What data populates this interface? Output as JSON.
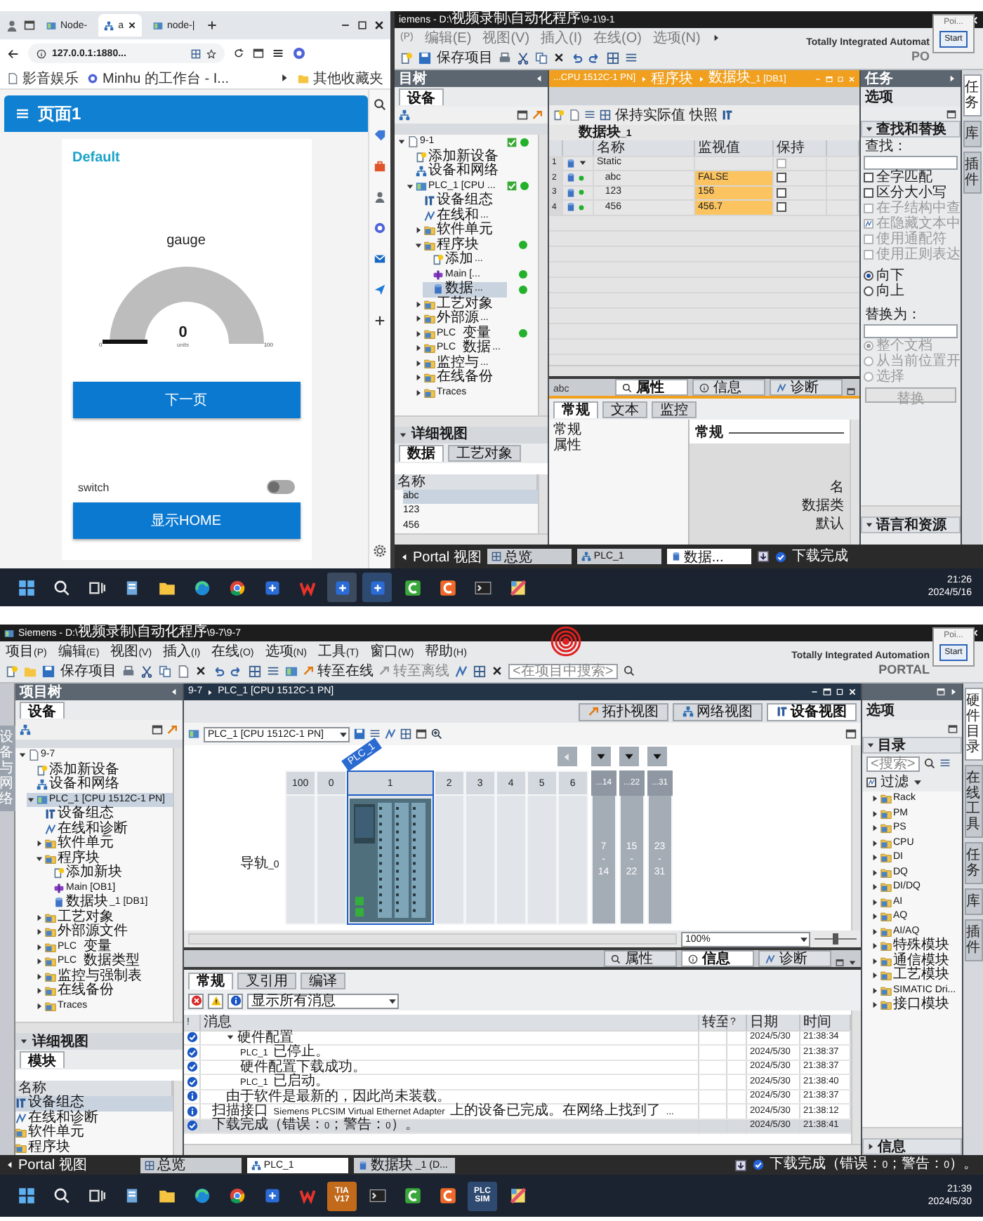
{
  "top_screen": {
    "browser": {
      "tabs": [
        {
          "label": "Node-",
          "selected": false
        },
        {
          "label": "a",
          "selected": true
        },
        {
          "label": "node-|",
          "selected": false
        }
      ],
      "address": "127.0.0.1:1880...",
      "bookmarks": [
        {
          "label": "影音娱乐",
          "kind": "page"
        },
        {
          "label": "Minhu 的工作台 - I...",
          "kind": "site"
        }
      ],
      "other_bookmarks": "其他收藏夹",
      "dashboard": {
        "title": "页面1",
        "group": "Default",
        "gauge": {
          "title": "gauge",
          "value": "0",
          "units": "units",
          "min": "0",
          "max": "100"
        },
        "next_button": "下一页",
        "switch": {
          "label": "switch",
          "on": false
        },
        "home_button": "显示HOME"
      }
    },
    "tia": {
      "title": "iemens - D:\\视频录制\\自动化程序\\9-1\\9-1",
      "menu": [
        "(P)",
        "编辑(E)",
        "视图(V)",
        "插入(I)",
        "在线(O)",
        "选项(N)"
      ],
      "save": "保存项目",
      "brand": "Totally Integrated Automat",
      "portal": "PO",
      "popup": {
        "title": "Poi...",
        "button": "Start"
      },
      "tree": {
        "header": "目树",
        "tab": "设备",
        "items": [
          {
            "label": "9-1",
            "kind": "project",
            "expanded": true,
            "consistent": true,
            "online": true,
            "selected": false,
            "children": [
              {
                "label": "添加新设备",
                "kind": "add",
                "selected": false
              },
              {
                "label": "设备和网络",
                "kind": "network",
                "selected": false
              },
              {
                "label": "PLC_1 [CPU ...",
                "kind": "plc",
                "expanded": true,
                "consistent": true,
                "online": true,
                "selected": false,
                "children": [
                  {
                    "label": "设备组态",
                    "kind": "config",
                    "selected": false
                  },
                  {
                    "label": "在线和...",
                    "kind": "diag",
                    "selected": false
                  },
                  {
                    "label": "软件单元",
                    "kind": "folder",
                    "expanded": false,
                    "selected": false
                  },
                  {
                    "label": "程序块",
                    "kind": "folder",
                    "expanded": true,
                    "online": true,
                    "selected": false,
                    "children": [
                      {
                        "label": "添加...",
                        "kind": "add",
                        "selected": false
                      },
                      {
                        "label": "Main [...",
                        "kind": "ob",
                        "online": true,
                        "selected": false
                      },
                      {
                        "label": "数据...",
                        "kind": "db",
                        "online": true,
                        "selected": true
                      }
                    ]
                  },
                  {
                    "label": "工艺对象",
                    "kind": "folder",
                    "expanded": false,
                    "selected": false
                  },
                  {
                    "label": "外部源...",
                    "kind": "folder",
                    "expanded": false,
                    "selected": false
                  },
                  {
                    "label": "PLC 变量",
                    "kind": "folder",
                    "expanded": false,
                    "online": true,
                    "selected": false
                  },
                  {
                    "label": "PLC 数据...",
                    "kind": "folder",
                    "expanded": false,
                    "selected": false
                  },
                  {
                    "label": "监控与...",
                    "kind": "folder",
                    "expanded": false,
                    "selected": false
                  },
                  {
                    "label": "在线备份",
                    "kind": "folder",
                    "expanded": false,
                    "selected": false
                  },
                  {
                    "label": "Traces",
                    "kind": "folder",
                    "expanded": false,
                    "selected": false
                  }
                ]
              }
            ]
          }
        ]
      },
      "detail": {
        "header": "详细视图",
        "tabs": [
          {
            "label": "数据",
            "selected": true
          },
          {
            "label": "工艺对象",
            "selected": false
          }
        ],
        "column": "名称",
        "rows": [
          {
            "label": "abc",
            "selected": true
          },
          {
            "label": "123",
            "selected": false
          },
          {
            "label": "456",
            "selected": false
          }
        ]
      },
      "editor": {
        "breadcrumb": [
          "...CPU 1512C-1 PN]",
          "程序块",
          "数据块_1 [DB1]"
        ],
        "tools": [
          "保持实际值",
          "快照"
        ],
        "block_title": "数据块_1",
        "columns": [
          "名称",
          "监视值",
          "保持"
        ],
        "rows": [
          {
            "no": "1",
            "name": "Static",
            "kind": "struct",
            "expanded": true,
            "retain": false
          },
          {
            "no": "2",
            "name": "abc",
            "kind": "var",
            "value": "FALSE",
            "retain": false
          },
          {
            "no": "3",
            "name": "123",
            "kind": "var",
            "value": "156",
            "retain": false
          },
          {
            "no": "4",
            "name": "456",
            "kind": "var",
            "value": "456.7",
            "retain": false
          }
        ]
      },
      "inspector": {
        "object": "abc",
        "tabs": [
          {
            "label": "属性",
            "kind": "props",
            "selected": true
          },
          {
            "label": "信息",
            "kind": "info",
            "selected": false
          },
          {
            "label": "诊断",
            "kind": "diag",
            "selected": false
          }
        ],
        "subtabs": [
          {
            "label": "常规",
            "selected": true
          },
          {
            "label": "文本",
            "selected": false
          },
          {
            "label": "监控",
            "selected": false
          }
        ],
        "nav": [
          "常规",
          "属性"
        ],
        "section": "常规",
        "fields": [
          "名",
          "数据类",
          "默认"
        ]
      },
      "tasks": {
        "header": "任务",
        "options": "选项",
        "find_section": "查找和替换",
        "find_label": "查找：",
        "checks": [
          {
            "label": "全字匹配",
            "checked": false,
            "disabled": false
          },
          {
            "label": "区分大小写",
            "checked": false,
            "disabled": false
          },
          {
            "label": "在子结构中查",
            "checked": false,
            "disabled": true
          },
          {
            "label": "在隐藏文本中",
            "checked": true,
            "disabled": true
          },
          {
            "label": "使用通配符",
            "checked": false,
            "disabled": true
          },
          {
            "label": "使用正则表达",
            "checked": false,
            "disabled": true
          }
        ],
        "direction": [
          {
            "label": "向下",
            "selected": true,
            "disabled": false
          },
          {
            "label": "向上",
            "selected": false,
            "disabled": false
          }
        ],
        "replace_label": "替换为：",
        "scope": [
          {
            "label": "整个文档",
            "selected": true,
            "disabled": true
          },
          {
            "label": "从当前位置开",
            "selected": false,
            "disabled": true
          },
          {
            "label": "选择",
            "selected": false,
            "disabled": true
          }
        ],
        "replace_button": "替换",
        "lang_section": "语言和资源"
      },
      "side_tabs": [
        {
          "label": "任务",
          "selected": true
        },
        {
          "label": "库",
          "selected": false
        },
        {
          "label": "插件",
          "selected": false
        }
      ],
      "status_bar": {
        "portal": "Portal 视图",
        "windows": [
          {
            "label": "总览",
            "kind": "overview",
            "selected": false
          },
          {
            "label": "PLC_1",
            "kind": "plc",
            "selected": false
          },
          {
            "label": "数据...",
            "kind": "db",
            "selected": true
          }
        ],
        "message": "下载完成"
      }
    },
    "taskbar": {
      "apps": [
        {
          "kind": "start",
          "selected": false
        },
        {
          "kind": "search",
          "selected": false
        },
        {
          "kind": "taskview",
          "selected": false
        },
        {
          "kind": "notes",
          "selected": false
        },
        {
          "kind": "folder",
          "selected": false
        },
        {
          "kind": "edge",
          "selected": false
        },
        {
          "kind": "chrome",
          "selected": false
        },
        {
          "kind": "app",
          "selected": false
        },
        {
          "kind": "wps",
          "selected": false
        },
        {
          "kind": "tia",
          "selected": false
        },
        {
          "kind": "plcsim",
          "selected": false
        },
        {
          "kind": "c-green",
          "selected": false
        },
        {
          "kind": "c-orange",
          "selected": false
        },
        {
          "kind": "terminal",
          "selected": false
        },
        {
          "kind": "paint",
          "selected": false
        }
      ],
      "time": "21:26",
      "date": "2024/5/16"
    }
  },
  "bottom_screen": {
    "tia": {
      "title": "Siemens - D:\\视频录制\\自动化程序\\9-7\\9-7",
      "menu": [
        "项目(P)",
        "编辑(E)",
        "视图(V)",
        "插入(I)",
        "在线(O)",
        "选项(N)",
        "工具(T)",
        "窗口(W)",
        "帮助(H)"
      ],
      "toolbar": {
        "save": "保存项目",
        "online": "转至在线",
        "offline": "转至离线",
        "search_placeholder": "<在项目中搜索>"
      },
      "brand": "Totally Integrated Automation",
      "portal": "PORTAL",
      "popup": {
        "title": "Poi...",
        "button": "Start"
      },
      "left_tab": "设备与网络",
      "tree": {
        "header": "项目树",
        "tab": "设备",
        "items": [
          {
            "label": "9-7",
            "kind": "project",
            "expanded": true,
            "selected": false,
            "children": [
              {
                "label": "添加新设备",
                "kind": "add",
                "selected": false
              },
              {
                "label": "设备和网络",
                "kind": "network",
                "selected": false
              },
              {
                "label": "PLC_1 [CPU 1512C-1 PN]",
                "kind": "plc",
                "expanded": true,
                "selected": true,
                "children": [
                  {
                    "label": "设备组态",
                    "kind": "config",
                    "selected": false
                  },
                  {
                    "label": "在线和诊断",
                    "kind": "diag",
                    "selected": false
                  },
                  {
                    "label": "软件单元",
                    "kind": "folder",
                    "expanded": false,
                    "selected": false
                  },
                  {
                    "label": "程序块",
                    "kind": "folder",
                    "expanded": true,
                    "selected": false,
                    "children": [
                      {
                        "label": "添加新块",
                        "kind": "add",
                        "selected": false
                      },
                      {
                        "label": "Main [OB1]",
                        "kind": "ob",
                        "selected": false
                      },
                      {
                        "label": "数据块_1 [DB1]",
                        "kind": "db",
                        "selected": false
                      }
                    ]
                  },
                  {
                    "label": "工艺对象",
                    "kind": "folder",
                    "expanded": false,
                    "selected": false
                  },
                  {
                    "label": "外部源文件",
                    "kind": "folder",
                    "expanded": false,
                    "selected": false
                  },
                  {
                    "label": "PLC 变量",
                    "kind": "folder",
                    "expanded": false,
                    "selected": false
                  },
                  {
                    "label": "PLC 数据类型",
                    "kind": "folder",
                    "expanded": false,
                    "selected": false
                  },
                  {
                    "label": "监控与强制表",
                    "kind": "folder",
                    "expanded": false,
                    "selected": false
                  },
                  {
                    "label": "在线备份",
                    "kind": "folder",
                    "expanded": false,
                    "selected": false
                  },
                  {
                    "label": "Traces",
                    "kind": "folder",
                    "expanded": false,
                    "selected": false
                  }
                ]
              }
            ]
          }
        ]
      },
      "detail": {
        "header": "详细视图",
        "tabs": [
          {
            "label": "模块",
            "selected": true
          }
        ],
        "column": "名称",
        "rows": [
          {
            "label": "设备组态",
            "kind": "config",
            "selected": true
          },
          {
            "label": "在线和诊断",
            "kind": "diag",
            "selected": false
          },
          {
            "label": "软件单元",
            "kind": "folder",
            "selected": false
          },
          {
            "label": "程序块",
            "kind": "folder",
            "selected": false
          }
        ]
      },
      "editor": {
        "breadcrumb": [
          "9-7",
          "PLC_1 [CPU 1512C-1 PN]"
        ],
        "views": [
          {
            "label": "拓扑视图",
            "kind": "topology",
            "selected": false
          },
          {
            "label": "网络视图",
            "kind": "network",
            "selected": false
          },
          {
            "label": "设备视图",
            "kind": "device",
            "selected": true
          }
        ],
        "device_select": "PLC_1 [CPU 1512C-1 PN]",
        "canvas": {
          "tag": "PLC_1",
          "rail": "导轨_0",
          "slots": [
            {
              "label": "100",
              "kind": "empty",
              "selected": false
            },
            {
              "label": "0",
              "kind": "empty",
              "selected": false
            },
            {
              "label": "1",
              "kind": "cpu",
              "selected": true
            },
            {
              "label": "2",
              "kind": "empty",
              "selected": false
            },
            {
              "label": "3",
              "kind": "empty",
              "selected": false
            },
            {
              "label": "4",
              "kind": "empty",
              "selected": false
            },
            {
              "label": "5",
              "kind": "empty",
              "selected": false
            },
            {
              "label": "6",
              "kind": "empty",
              "selected": false
            }
          ],
          "expansion": [
            {
              "label": "...14",
              "range": [
                "7",
                "-",
                "14"
              ]
            },
            {
              "label": "...22",
              "range": [
                "15",
                "-",
                "22"
              ]
            },
            {
              "label": "...31",
              "range": [
                "23",
                "-",
                "31"
              ]
            }
          ]
        },
        "zoom": "100%",
        "zoom_slider": {
          "level": 0.5
        }
      },
      "inspector": {
        "tabs": [
          {
            "label": "属性",
            "kind": "props",
            "selected": false
          },
          {
            "label": "信息",
            "kind": "info",
            "selected": true
          },
          {
            "label": "诊断",
            "kind": "diag",
            "selected": false
          }
        ],
        "subtabs": [
          {
            "label": "常规",
            "selected": true
          },
          {
            "label": "叉引用",
            "selected": false
          },
          {
            "label": "编译",
            "selected": false
          }
        ],
        "filter": "显示所有消息",
        "columns": [
          "!",
          "消息",
          "转至",
          "?",
          "日期",
          "时间"
        ],
        "messages": [
          {
            "children": [
              {
                "text": "硬件配置",
                "kind": "ok",
                "expanded": true,
                "date": "2024/5/30",
                "time": "21:38:34",
                "selected": false,
                "children": [
                  {
                    "text": "PLC_1 已停止。",
                    "kind": "ok",
                    "date": "2024/5/30",
                    "time": "21:38:37",
                    "selected": false
                  },
                  {
                    "text": "硬件配置下载成功。",
                    "kind": "ok",
                    "date": "2024/5/30",
                    "time": "21:38:37",
                    "selected": false
                  },
                  {
                    "text": "PLC_1 已启动。",
                    "kind": "ok",
                    "date": "2024/5/30",
                    "time": "21:38:40",
                    "selected": false
                  }
                ]
              },
              {
                "text": "由于软件是最新的，因此尚未装载。",
                "kind": "info",
                "date": "2024/5/30",
                "time": "21:38:37",
                "selected": false
              }
            ]
          },
          {
            "text": "扫描接口 Siemens PLCSIM Virtual Ethernet Adapter 上的设备已完成。在网络上找到了 ...",
            "kind": "info",
            "date": "2024/5/30",
            "time": "21:38:12",
            "selected": false
          },
          {
            "text": "下载完成（错误：0；警告：0）。",
            "kind": "ok",
            "date": "2024/5/30",
            "time": "21:38:41",
            "selected": true
          }
        ]
      },
      "catalog": {
        "options": "选项",
        "section": "目录",
        "search_placeholder": "<搜索>",
        "filter": {
          "label": "过滤",
          "checked": true
        },
        "items": [
          "Rack",
          "PM",
          "PS",
          "CPU",
          "DI",
          "DQ",
          "DI/DQ",
          "AI",
          "AQ",
          "AI/AQ",
          "特殊模块",
          "通信模块",
          "工艺模块",
          "SIMATIC Dri...",
          "接口模块"
        ],
        "info": "信息"
      },
      "side_tabs": [
        {
          "label": "硬件目录",
          "selected": true
        },
        {
          "label": "在线工具",
          "selected": false
        },
        {
          "label": "任务",
          "selected": false
        },
        {
          "label": "库",
          "selected": false
        },
        {
          "label": "插件",
          "selected": false
        }
      ],
      "status_bar": {
        "portal": "Portal 视图",
        "windows": [
          {
            "label": "总览",
            "kind": "overview",
            "selected": false
          },
          {
            "label": "PLC_1",
            "kind": "plc",
            "selected": true
          },
          {
            "label": "数据块_1 (D...",
            "kind": "db",
            "selected": false
          }
        ],
        "message": "下载完成（错误：0；警告：0）。"
      }
    },
    "taskbar": {
      "apps": [
        {
          "kind": "start",
          "selected": false
        },
        {
          "kind": "search",
          "selected": false
        },
        {
          "kind": "taskview",
          "selected": false
        },
        {
          "kind": "notes",
          "selected": false
        },
        {
          "kind": "folder",
          "selected": false
        },
        {
          "kind": "edge",
          "selected": false
        },
        {
          "kind": "chrome",
          "selected": false
        },
        {
          "kind": "app",
          "selected": false
        },
        {
          "kind": "wps",
          "selected": false
        },
        {
          "kind": "tia",
          "label": [
            "TIA",
            "V17"
          ],
          "selected": true
        },
        {
          "kind": "terminal",
          "selected": false
        },
        {
          "kind": "c-green",
          "selected": false
        },
        {
          "kind": "c-orange",
          "selected": false
        },
        {
          "kind": "plcsim",
          "label": [
            "PLC",
            "SIM"
          ],
          "selected": false
        },
        {
          "kind": "paint",
          "selected": false
        }
      ],
      "time": "21:39",
      "date": "2024/5/30"
    }
  }
}
